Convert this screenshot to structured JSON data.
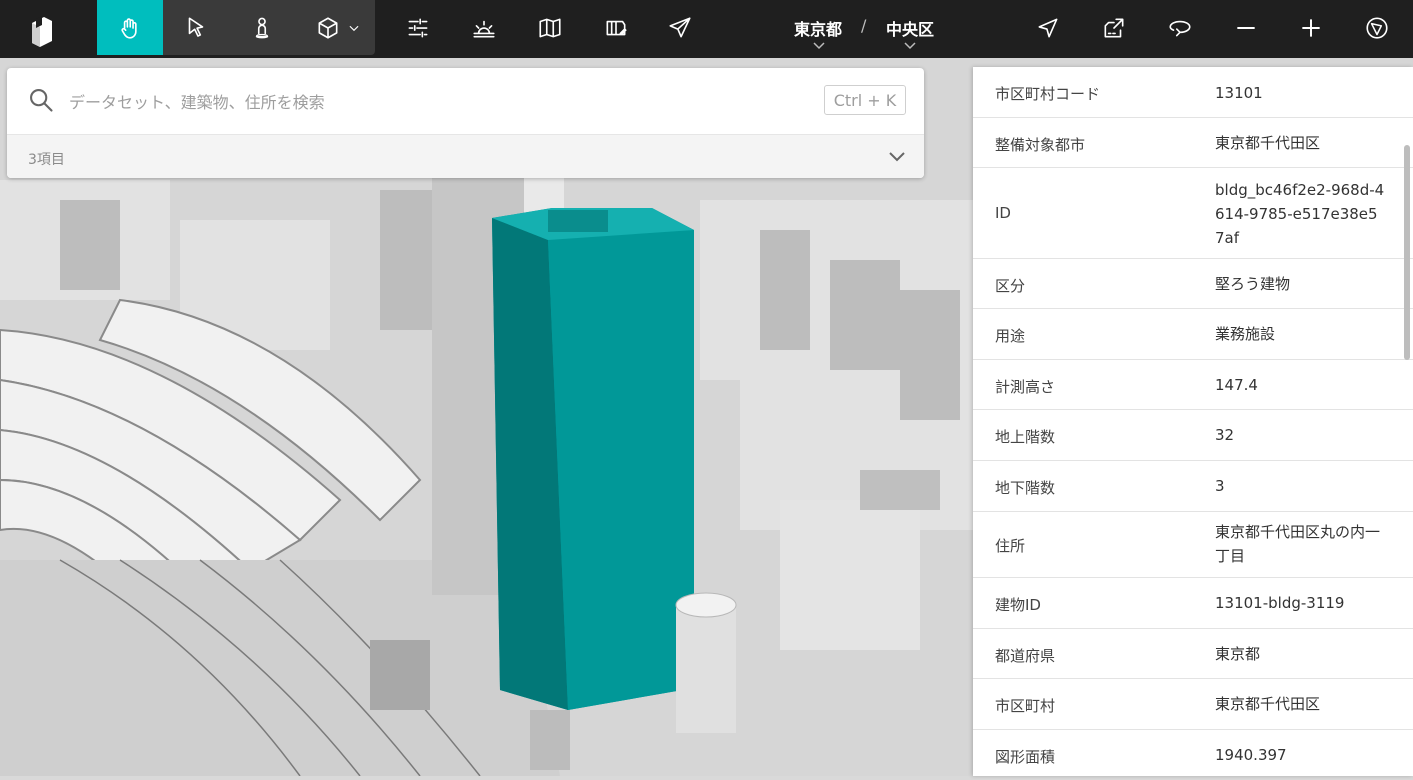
{
  "header": {
    "breadcrumb": [
      "東京都",
      "中央区"
    ],
    "separator": "/"
  },
  "toolbar": {
    "left_tools": [
      {
        "name": "hand-tool",
        "active": true
      },
      {
        "name": "select-tool"
      },
      {
        "name": "pedestrian-tool"
      },
      {
        "name": "sketch-tool"
      }
    ],
    "right_icons": [
      "location-icon",
      "export-icon",
      "rotate-icon",
      "zoom-out-icon",
      "zoom-in-icon",
      "compass-icon"
    ],
    "accent": "#00bebe"
  },
  "search": {
    "placeholder": "データセット、建築物、住所を検索",
    "shortcut": "Ctrl + K",
    "count": "3項目"
  },
  "attributes": [
    {
      "key": "市区町村コード",
      "value": "13101"
    },
    {
      "key": "整備対象都市",
      "value": "東京都千代田区"
    },
    {
      "key": "ID",
      "value": "bldg_bc46f2e2-968d-4614-9785-e517e38e57af"
    },
    {
      "key": "区分",
      "value": "堅ろう建物"
    },
    {
      "key": "用途",
      "value": "業務施設"
    },
    {
      "key": "計測高さ",
      "value": "147.4"
    },
    {
      "key": "地上階数",
      "value": "32"
    },
    {
      "key": "地下階数",
      "value": "3"
    },
    {
      "key": "住所",
      "value": "東京都千代田区丸の内一丁目"
    },
    {
      "key": "建物ID",
      "value": "13101-bldg-3119"
    },
    {
      "key": "都道府県",
      "value": "東京都"
    },
    {
      "key": "市区町村",
      "value": "東京都千代田区"
    },
    {
      "key": "図形面積",
      "value": "1940.397"
    }
  ]
}
